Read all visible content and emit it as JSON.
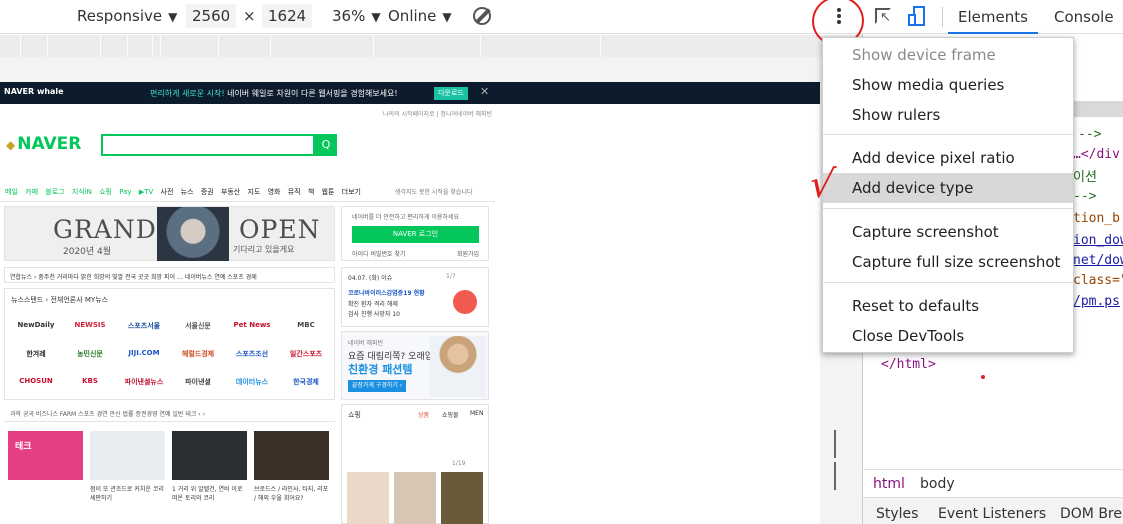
{
  "device_toolbar": {
    "device": "Responsive",
    "width": "2560",
    "times": "×",
    "height": "1624",
    "zoom": "36%",
    "network": "Online"
  },
  "preview": {
    "whale_logo": "NAVER whale",
    "whale_text_hl": "편리하게 새로운 시작!",
    "whale_text": " 네이버 웨일로 차원이 다른 웹서핑을 경험해보세요!",
    "whale_button": "다운로드",
    "whale_close": "✕",
    "top_links": "나의의 시작페이지로  |  정니어네이버  해피빈",
    "naver_logo": "NAVER",
    "search_button": "Q",
    "nav_items": [
      "메일",
      "카페",
      "블로그",
      "지식iN",
      "쇼핑",
      "Pay",
      "▶TV"
    ],
    "nav_items_dark": [
      "사전",
      "뉴스",
      "증권",
      "부동산",
      "지도",
      "영화",
      "뮤직",
      "책",
      "웹툰"
    ],
    "nav_more": "더보기",
    "nav_right": "생각지도 못한 시작을 찾습니다",
    "banner_title_left": "GRAND",
    "banner_title_right": "OPEN",
    "banner_sub_left": "2020년 4월",
    "banner_sub_right": "기다리고 있을게요",
    "login_tip": "네이버를 더 안전하고 편리하게 이용하세요",
    "login_button": "NAVER 로그인",
    "login_links_left": "아이디 비밀번호 찾기",
    "login_links_right": "회원가입",
    "news_line": "연합뉴스 › 충주천 거리마다 밝힌 희망의 빛깔 전국 곳곳 희망 피어 …  네이버뉴스  연예  스포츠  경제",
    "newsstand_title": "뉴스스탠드 › 전체언론사   MY뉴스",
    "newsstand_logos": [
      "NewDaily",
      "NEWSIS",
      "스포츠서울",
      "서울신문",
      "Pet News",
      "MBC",
      "한겨레",
      "농민신문",
      "JIJI.COM",
      "헤럴드경제",
      "스포츠조선",
      "일간스포츠",
      "CHOSUN",
      "KBS",
      "파이낸셜뉴스",
      "파이낸셜",
      "데이터뉴스",
      "한국경제"
    ],
    "side_news_date": "04.07. (화) 이슈",
    "side_news_page": "1/7",
    "side_news_rows": [
      "코로나바이러스감염증19 현황",
      "확진 환자   격리 해제",
      "검사 진행   사망자 10"
    ],
    "ad_label": "네이버 해피빈",
    "ad_line1": "요즘 대림리쪽? 오래입는",
    "ad_line2": "친환경 패션템",
    "ad_button": "끝장가게 구경하기 ›",
    "cat_row": "과학  공곡  비즈니스  FARM  스포츠  경연 만신  법률  증권경영  연예 일반  테크   ‹  ›",
    "thumb_caps": [
      "테크",
      "점이 또 관조드로 커치운\n코리 세판하기",
      "1 거리 위 알렐건, 연비\n이로 떠온 토리와 코리",
      "브로드스 / 라인사, 타지,\n리포 / 해외 우울 회어요?"
    ],
    "shop_title": "쇼핑",
    "shop_tabs": [
      "상품",
      "쇼핑몰",
      "MEN"
    ],
    "shop_page": "1/19"
  },
  "devtools": {
    "tabs": {
      "elements": "Elements",
      "console": "Console"
    },
    "code": {
      "l1": "-->",
      "l2": "…</div",
      "l3": "이션",
      "l4": "-->",
      "l5": "tion_b",
      "l6": "ion_dow",
      "l7": "net/dow",
      "l8": "class=\"",
      "l9": "/pm.ps",
      "html_close": "</html>"
    },
    "breadcrumbs": [
      "html",
      "body"
    ],
    "subtabs": [
      "Styles",
      "Event Listeners",
      "DOM Brea"
    ]
  },
  "menu": {
    "items": [
      {
        "label": "Show device frame",
        "disabled": true
      },
      {
        "label": "Show media queries"
      },
      {
        "label": "Show rulers"
      },
      {
        "label": "Add device pixel ratio"
      },
      {
        "label": "Add device type"
      },
      {
        "label": "Capture screenshot"
      },
      {
        "label": "Capture full size screenshot"
      },
      {
        "label": "Reset to defaults"
      },
      {
        "label": "Close DevTools"
      }
    ]
  },
  "annotations": {
    "checkmark": "√"
  },
  "colors": {
    "naver_green": "#03c75a",
    "devtools_blue": "#1a73e8",
    "annotation_red": "#e0201c",
    "menu_hover": "#d8d8d8"
  },
  "icons": [
    "chevron-down-icon",
    "rotate-icon",
    "kebab-menu-icon",
    "inspect-element-icon",
    "device-toolbar-icon",
    "drag-handle-icon"
  ]
}
